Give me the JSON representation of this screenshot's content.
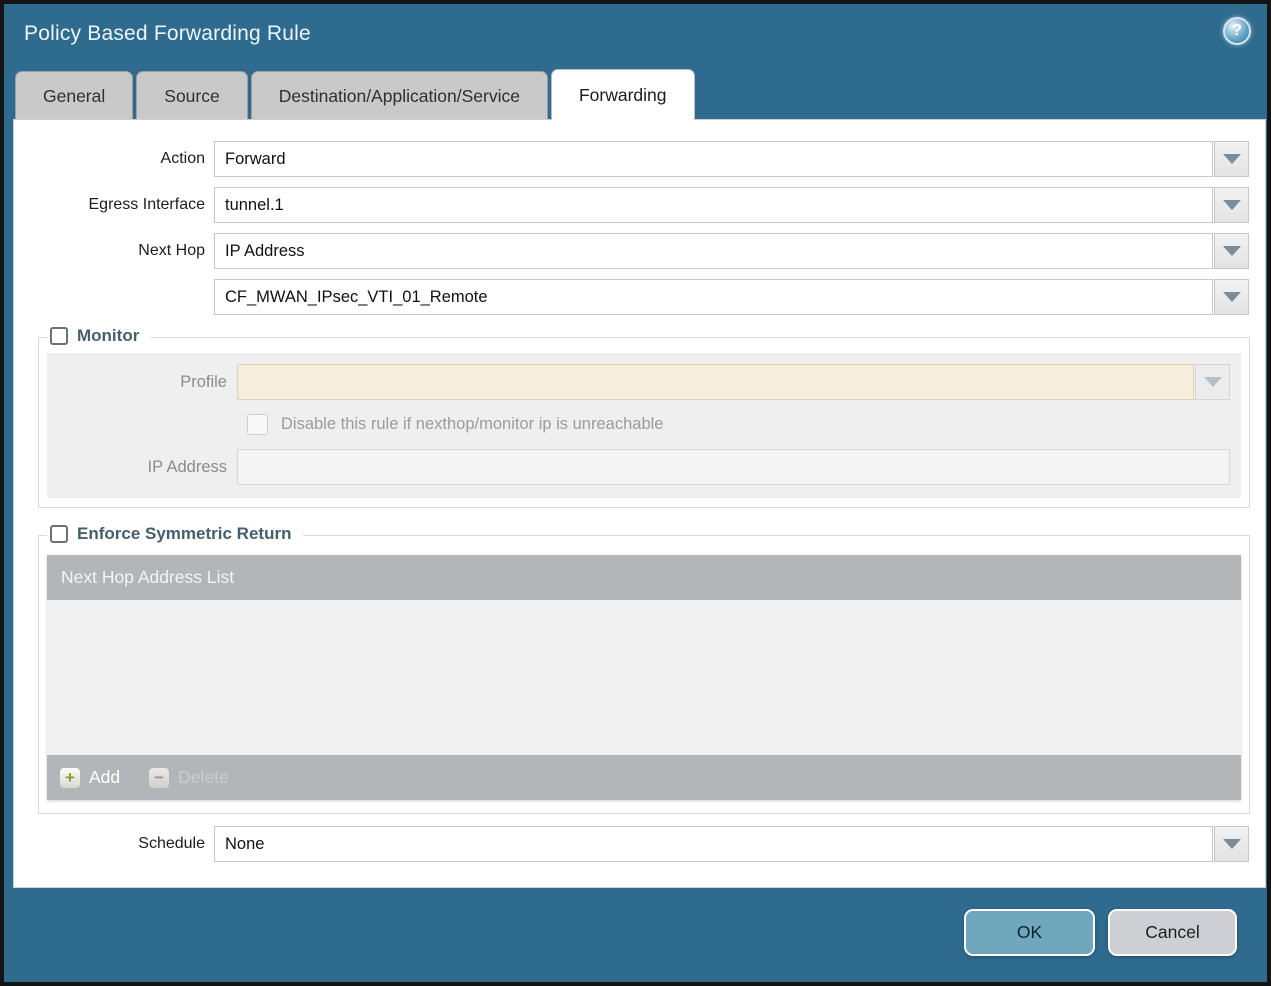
{
  "window": {
    "title": "Policy Based Forwarding Rule",
    "help_icon": "?"
  },
  "tabs": [
    {
      "label": "General",
      "active": false
    },
    {
      "label": "Source",
      "active": false
    },
    {
      "label": "Destination/Application/Service",
      "active": false
    },
    {
      "label": "Forwarding",
      "active": true
    }
  ],
  "form": {
    "action_label": "Action",
    "action_value": "Forward",
    "egress_label": "Egress Interface",
    "egress_value": "tunnel.1",
    "next_hop_label": "Next Hop",
    "next_hop_value": "IP Address",
    "next_hop_address_value": "CF_MWAN_IPsec_VTI_01_Remote",
    "schedule_label": "Schedule",
    "schedule_value": "None"
  },
  "monitor": {
    "title": "Monitor",
    "checked": false,
    "profile_label": "Profile",
    "profile_value": "",
    "disable_rule_label": "Disable this rule if nexthop/monitor ip is unreachable",
    "disable_rule_checked": false,
    "ip_address_label": "IP Address",
    "ip_address_value": ""
  },
  "enforce_symmetric_return": {
    "title": "Enforce Symmetric Return",
    "checked": false,
    "table_header": "Next Hop Address List",
    "rows": [],
    "add_label": "Add",
    "add_icon": "+",
    "delete_label": "Delete",
    "delete_icon": "−",
    "delete_enabled": false
  },
  "footer": {
    "ok_label": "OK",
    "cancel_label": "Cancel"
  },
  "colors": {
    "titlebar_bg": "#2E6B8F",
    "active_tab_bg": "#FFFFFF",
    "inactive_tab_bg": "#C9C9C9",
    "section_title_text": "#44606E",
    "profile_field_bg": "#F5EEDC",
    "table_header_bg": "#B3B6B8",
    "ok_button_bg": "#6FA8BC",
    "cancel_button_bg": "#CDCFD4",
    "add_icon_green": "#8A9A2E",
    "delete_icon_red": "#C4767B"
  }
}
